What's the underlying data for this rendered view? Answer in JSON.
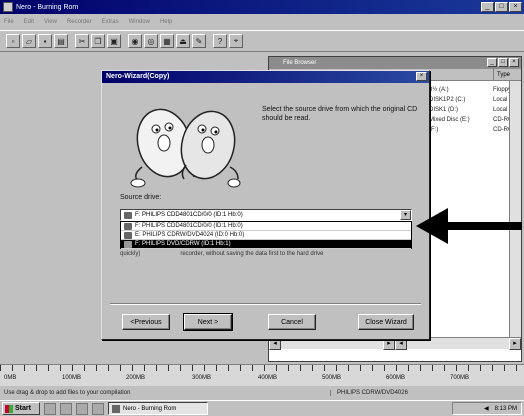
{
  "window": {
    "title": "Nero - Burning Rom"
  },
  "menubar": {
    "items": [
      "File",
      "Edit",
      "View",
      "Recorder",
      "Extras",
      "Window",
      "Help"
    ]
  },
  "file_panel": {
    "title": "File Browser",
    "type_header": "Type",
    "rows": [
      {
        "name": "3½ (A:)",
        "type": "Floppy"
      },
      {
        "name": "DISK1P2 (C:)",
        "type": "Local D"
      },
      {
        "name": "DISK1 (D:)",
        "type": "Local D"
      },
      {
        "name": "Mixed Disc (E:)",
        "type": "CD-RO"
      },
      {
        "name": "(F:)",
        "type": "CD-RO"
      }
    ]
  },
  "dialog": {
    "title": "Nero-Wizard(Copy)",
    "instruction": "Select the source drive from which the original CD should be read.",
    "source_label": "Source drive:",
    "combo_value": "F: PHILIPS CDD4801CD/0/0 (ID:1 Hb:0)",
    "options": [
      "F: PHILIPS CDD4801CD/0/0 (ID:1 Hb:0)",
      "E: PHILIPS CDRW/DVD4024 (ID:0 Hb:0)",
      "F: PHILIPS DVD/CDRW (ID:1 Hb:1)"
    ],
    "behind_text_left": "quickly)",
    "behind_text_right": "recorder, without saving the data first to the hard drive",
    "buttons": {
      "previous": "<Previous",
      "next": "Next >",
      "cancel": "Cancel",
      "close_wizard": "Close Wizard"
    }
  },
  "ruler": {
    "labels": [
      "0MB",
      "100MB",
      "200MB",
      "300MB",
      "400MB",
      "500MB",
      "600MB",
      "700MB"
    ]
  },
  "statusbar": {
    "left": "Use drag & drop to add files to your compilation",
    "right": "PHILIPS CDRW/DVD4026"
  },
  "taskbar": {
    "start_label": "Start",
    "task_label": "Nero - Burning Rom",
    "clock": "8:13 PM"
  }
}
